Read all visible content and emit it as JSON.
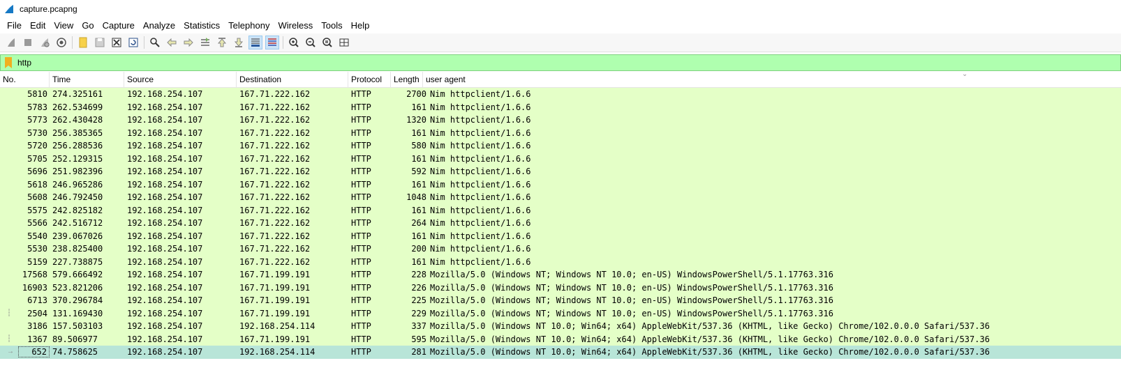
{
  "window": {
    "title": "capture.pcapng"
  },
  "menu": [
    "File",
    "Edit",
    "View",
    "Go",
    "Capture",
    "Analyze",
    "Statistics",
    "Telephony",
    "Wireless",
    "Tools",
    "Help"
  ],
  "toolbar_icons": [
    "start-capture-icon",
    "stop-capture-icon",
    "restart-capture-icon",
    "capture-options-icon",
    "open-file-icon",
    "save-file-icon",
    "close-file-icon",
    "reload-file-icon",
    "find-packet-icon",
    "go-back-icon",
    "go-forward-icon",
    "go-to-packet-icon",
    "go-first-icon",
    "go-last-icon",
    "auto-scroll-icon",
    "colorize-icon",
    "zoom-in-icon",
    "zoom-out-icon",
    "zoom-normal-icon",
    "resize-columns-icon"
  ],
  "filter": {
    "value": "http"
  },
  "columns": [
    "No.",
    "Time",
    "Source",
    "Destination",
    "Protocol",
    "Length",
    "user agent"
  ],
  "colors": {
    "row_bg": "#e4ffc7",
    "selected_bg": "#b8e5d8",
    "filter_bg": "#afffaf"
  },
  "packets": [
    {
      "no": "5810",
      "time": "274.325161",
      "src": "192.168.254.107",
      "dst": "167.71.222.162",
      "proto": "HTTP",
      "len": "2700",
      "ua": "Nim httpclient/1.6.6"
    },
    {
      "no": "5783",
      "time": "262.534699",
      "src": "192.168.254.107",
      "dst": "167.71.222.162",
      "proto": "HTTP",
      "len": "161",
      "ua": "Nim httpclient/1.6.6"
    },
    {
      "no": "5773",
      "time": "262.430428",
      "src": "192.168.254.107",
      "dst": "167.71.222.162",
      "proto": "HTTP",
      "len": "1320",
      "ua": "Nim httpclient/1.6.6"
    },
    {
      "no": "5730",
      "time": "256.385365",
      "src": "192.168.254.107",
      "dst": "167.71.222.162",
      "proto": "HTTP",
      "len": "161",
      "ua": "Nim httpclient/1.6.6"
    },
    {
      "no": "5720",
      "time": "256.288536",
      "src": "192.168.254.107",
      "dst": "167.71.222.162",
      "proto": "HTTP",
      "len": "580",
      "ua": "Nim httpclient/1.6.6"
    },
    {
      "no": "5705",
      "time": "252.129315",
      "src": "192.168.254.107",
      "dst": "167.71.222.162",
      "proto": "HTTP",
      "len": "161",
      "ua": "Nim httpclient/1.6.6"
    },
    {
      "no": "5696",
      "time": "251.982396",
      "src": "192.168.254.107",
      "dst": "167.71.222.162",
      "proto": "HTTP",
      "len": "592",
      "ua": "Nim httpclient/1.6.6"
    },
    {
      "no": "5618",
      "time": "246.965286",
      "src": "192.168.254.107",
      "dst": "167.71.222.162",
      "proto": "HTTP",
      "len": "161",
      "ua": "Nim httpclient/1.6.6"
    },
    {
      "no": "5608",
      "time": "246.792450",
      "src": "192.168.254.107",
      "dst": "167.71.222.162",
      "proto": "HTTP",
      "len": "1048",
      "ua": "Nim httpclient/1.6.6"
    },
    {
      "no": "5575",
      "time": "242.825182",
      "src": "192.168.254.107",
      "dst": "167.71.222.162",
      "proto": "HTTP",
      "len": "161",
      "ua": "Nim httpclient/1.6.6"
    },
    {
      "no": "5566",
      "time": "242.516712",
      "src": "192.168.254.107",
      "dst": "167.71.222.162",
      "proto": "HTTP",
      "len": "264",
      "ua": "Nim httpclient/1.6.6"
    },
    {
      "no": "5540",
      "time": "239.067026",
      "src": "192.168.254.107",
      "dst": "167.71.222.162",
      "proto": "HTTP",
      "len": "161",
      "ua": "Nim httpclient/1.6.6"
    },
    {
      "no": "5530",
      "time": "238.825400",
      "src": "192.168.254.107",
      "dst": "167.71.222.162",
      "proto": "HTTP",
      "len": "200",
      "ua": "Nim httpclient/1.6.6"
    },
    {
      "no": "5159",
      "time": "227.738875",
      "src": "192.168.254.107",
      "dst": "167.71.222.162",
      "proto": "HTTP",
      "len": "161",
      "ua": "Nim httpclient/1.6.6"
    },
    {
      "no": "17568",
      "time": "579.666492",
      "src": "192.168.254.107",
      "dst": "167.71.199.191",
      "proto": "HTTP",
      "len": "228",
      "ua": "Mozilla/5.0 (Windows NT; Windows NT 10.0; en-US) WindowsPowerShell/5.1.17763.316"
    },
    {
      "no": "16903",
      "time": "523.821206",
      "src": "192.168.254.107",
      "dst": "167.71.199.191",
      "proto": "HTTP",
      "len": "226",
      "ua": "Mozilla/5.0 (Windows NT; Windows NT 10.0; en-US) WindowsPowerShell/5.1.17763.316"
    },
    {
      "no": "6713",
      "time": "370.296784",
      "src": "192.168.254.107",
      "dst": "167.71.199.191",
      "proto": "HTTP",
      "len": "225",
      "ua": "Mozilla/5.0 (Windows NT; Windows NT 10.0; en-US) WindowsPowerShell/5.1.17763.316"
    },
    {
      "no": "2504",
      "time": "131.169430",
      "src": "192.168.254.107",
      "dst": "167.71.199.191",
      "proto": "HTTP",
      "len": "229",
      "ua": "Mozilla/5.0 (Windows NT; Windows NT 10.0; en-US) WindowsPowerShell/5.1.17763.316",
      "rel": "dashed"
    },
    {
      "no": "3186",
      "time": "157.503103",
      "src": "192.168.254.107",
      "dst": "192.168.254.114",
      "proto": "HTTP",
      "len": "337",
      "ua": "Mozilla/5.0 (Windows NT 10.0; Win64; x64) AppleWebKit/537.36 (KHTML, like Gecko) Chrome/102.0.0.0 Safari/537.36"
    },
    {
      "no": "1367",
      "time": "89.506977",
      "src": "192.168.254.107",
      "dst": "167.71.199.191",
      "proto": "HTTP",
      "len": "595",
      "ua": "Mozilla/5.0 (Windows NT 10.0; Win64; x64) AppleWebKit/537.36 (KHTML, like Gecko) Chrome/102.0.0.0 Safari/537.36",
      "rel": "dashed"
    },
    {
      "no": "652",
      "time": "74.758625",
      "src": "192.168.254.107",
      "dst": "192.168.254.114",
      "proto": "HTTP",
      "len": "281",
      "ua": "Mozilla/5.0 (Windows NT 10.0; Win64; x64) AppleWebKit/537.36 (KHTML, like Gecko) Chrome/102.0.0.0 Safari/537.36",
      "selected": true,
      "rel": "arrow"
    }
  ]
}
